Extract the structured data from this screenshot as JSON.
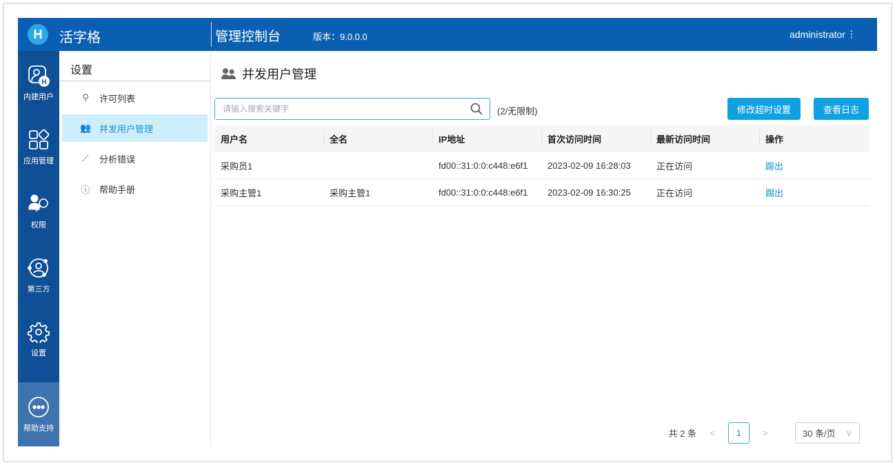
{
  "header": {
    "logo_letter": "H",
    "app_name": "活字格",
    "console_title": "管理控制台",
    "version": "版本：9.0.0.0",
    "user": "administrator",
    "menu_icon": "⋮"
  },
  "rail": [
    {
      "label": "内建用户",
      "icon": "builtin-user-icon"
    },
    {
      "label": "应用管理",
      "icon": "app-grid-icon"
    },
    {
      "label": "权限",
      "icon": "user-key-icon"
    },
    {
      "label": "第三方",
      "icon": "third-party-icon"
    },
    {
      "label": "设置",
      "icon": "gear-icon"
    },
    {
      "label": "帮助支持",
      "icon": "more-icon"
    }
  ],
  "sidebar": {
    "title": "设置",
    "items": [
      {
        "label": "许可列表",
        "icon": "key-icon"
      },
      {
        "label": "并发用户管理",
        "icon": "users-icon"
      },
      {
        "label": "分析错误",
        "icon": "chart-line-icon"
      },
      {
        "label": "帮助手册",
        "icon": "help-icon"
      }
    ]
  },
  "main": {
    "title": "并发用户管理",
    "search_placeholder": "请输入搜索关键字",
    "search_value": "",
    "count": "(2/无限制)",
    "btn_timeout": "修改超时设置",
    "btn_log": "查看日志",
    "columns": [
      "用户名",
      "全名",
      "IP地址",
      "首次访问时间",
      "最新访问时间",
      "操作"
    ],
    "rows": [
      [
        "采购员1",
        "",
        "fd00::31:0:0:c448:e6f1",
        "2023-02-09 16:28:03",
        "正在访问",
        "踢出"
      ],
      [
        "采购主管1",
        "采购主管1",
        "fd00::31:0:0:c448:e6f1",
        "2023-02-09 16:30:25",
        "正在访问",
        "踢出"
      ]
    ]
  },
  "pager": {
    "total": "共 2 条",
    "prev": "<",
    "page": "1",
    "next": ">",
    "size": "30 条/页",
    "dropdown": "∨"
  }
}
